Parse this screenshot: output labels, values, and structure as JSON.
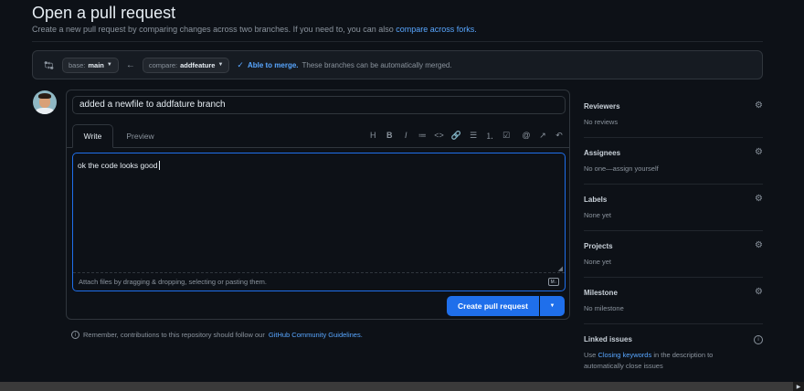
{
  "header": {
    "title": "Open a pull request",
    "subtitle": "Create a new pull request by comparing changes across two branches. If you need to, you can also",
    "subtitle_link": "compare across forks."
  },
  "compare": {
    "base_prefix": "base:",
    "base_branch": "main",
    "compare_prefix": "compare:",
    "compare_branch": "addfeature",
    "merge_status": "Able to merge.",
    "merge_note": "These branches can be automatically merged."
  },
  "editor": {
    "title_value": "added a newfile to addfature branch",
    "tabs": [
      "Write",
      "Preview"
    ],
    "toolbar": [
      "H",
      "B",
      "I",
      "≔",
      "<>",
      "🔗",
      "☰",
      "⒈",
      "☑",
      "@",
      "↗",
      "↶"
    ],
    "body_value": "ok the code looks good",
    "attach_text": "Attach files by dragging & dropping, selecting or pasting them.",
    "md_badge": "M↓"
  },
  "actions": {
    "create_label": "Create pull request"
  },
  "guidelines": {
    "text": "Remember, contributions to this repository should follow our",
    "link": "GitHub Community Guidelines."
  },
  "sidebar": {
    "reviewers": {
      "label": "Reviewers",
      "value": "No reviews"
    },
    "assignees": {
      "label": "Assignees",
      "value": "No one—assign yourself"
    },
    "labels": {
      "label": "Labels",
      "value": "None yet"
    },
    "projects": {
      "label": "Projects",
      "value": "None yet"
    },
    "milestone": {
      "label": "Milestone",
      "value": "No milestone"
    },
    "linked": {
      "label": "Linked issues",
      "pre": "Use",
      "link": "Closing keywords",
      "post": "in the description to automatically close issues"
    }
  },
  "colors": {
    "background": "#0d1117",
    "accent": "#1f6feb",
    "link": "#58a6ff"
  }
}
